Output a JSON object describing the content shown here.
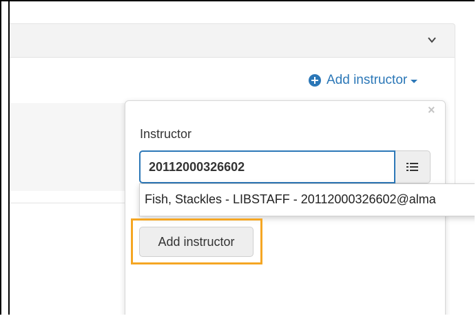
{
  "header": {
    "chevron_icon": "chevron-down-icon"
  },
  "toolbar": {
    "add_instructor_link": "Add instructor",
    "plus_icon": "plus-circle-icon",
    "caret_icon": "caret-down-icon"
  },
  "popover": {
    "close_label": "×",
    "instructor_label": "Instructor",
    "instructor_input_value": "20112000326602",
    "list_icon": "list-icon",
    "suggestion": "Fish, Stackles - LIBSTAFF - 20112000326602@alma",
    "add_button_label": "Add instructor"
  },
  "colors": {
    "link": "#2b77b7",
    "highlight": "#f5a623"
  }
}
